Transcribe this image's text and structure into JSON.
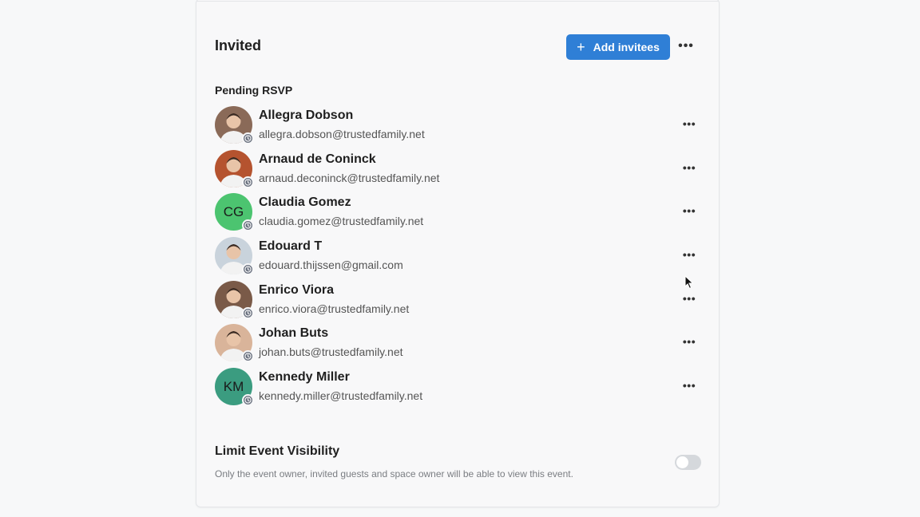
{
  "header": {
    "title": "Invited",
    "add_button_label": "Add invitees",
    "more_label": "•••"
  },
  "section": {
    "label": "Pending RSVP"
  },
  "invitees": [
    {
      "name": "Allegra Dobson",
      "email": "allegra.dobson@trustedfamily.net",
      "initials": "",
      "avatar": "photo",
      "avatar_color": "#8a6a58"
    },
    {
      "name": "Arnaud de Coninck",
      "email": "arnaud.deconinck@trustedfamily.net",
      "initials": "",
      "avatar": "photo",
      "avatar_color": "#b5532f"
    },
    {
      "name": "Claudia Gomez",
      "email": "claudia.gomez@trustedfamily.net",
      "initials": "CG",
      "avatar": "initials",
      "avatar_color": "#4cc470"
    },
    {
      "name": "Edouard T",
      "email": "edouard.thijssen@gmail.com",
      "initials": "",
      "avatar": "photo",
      "avatar_color": "#c9d3dc"
    },
    {
      "name": "Enrico Viora",
      "email": "enrico.viora@trustedfamily.net",
      "initials": "",
      "avatar": "photo",
      "avatar_color": "#7a5a48"
    },
    {
      "name": "Johan Buts",
      "email": "johan.buts@trustedfamily.net",
      "initials": "",
      "avatar": "photo",
      "avatar_color": "#d9b49a"
    },
    {
      "name": "Kennedy Miller",
      "email": "kennedy.miller@trustedfamily.net",
      "initials": "KM",
      "avatar": "initials",
      "avatar_color": "#3b9c80"
    }
  ],
  "visibility": {
    "title": "Limit Event Visibility",
    "description": "Only the event owner, invited guests and space owner will be able to view this event.",
    "enabled": false
  },
  "colors": {
    "accent": "#2f7fd6",
    "badge": "#6b7280",
    "toggle_off": "#d5d8dc"
  }
}
